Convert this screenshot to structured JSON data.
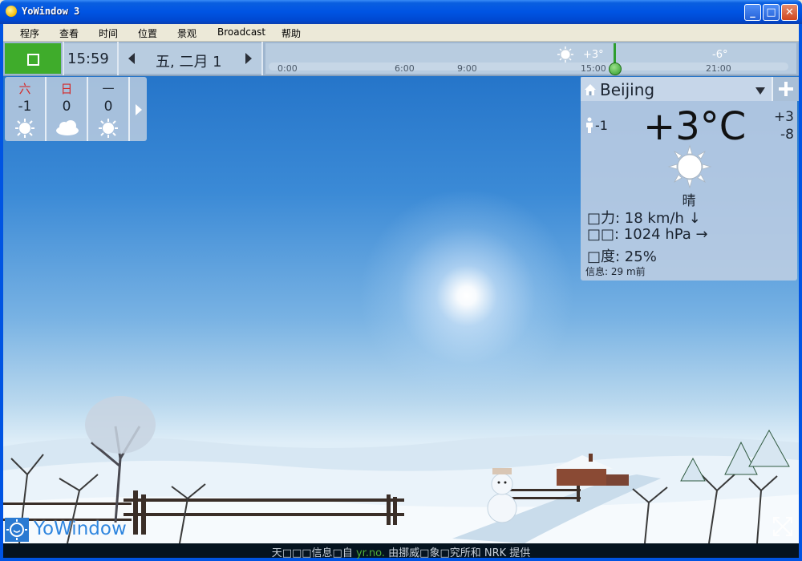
{
  "window": {
    "title": "YoWindow 3"
  },
  "menu": {
    "items": [
      "程序",
      "查看",
      "时间",
      "位置",
      "景观",
      "Broadcast",
      "帮助"
    ]
  },
  "colors": {
    "accent_green": "#3fac2b",
    "sky_top": "#1f6fc6",
    "panel": "#bccee2"
  },
  "timebar": {
    "time": "15:59",
    "date": "五, 二月 1",
    "ticks": [
      "0:00",
      "6:00",
      "9:00",
      "15:00",
      "21:00"
    ],
    "temps": [
      "+3°",
      "-6°"
    ],
    "icons": {
      "sun": "sun-icon"
    }
  },
  "forecast": {
    "days": [
      {
        "name": "六",
        "temp": "-1",
        "icon": "sun-icon",
        "weekend": true
      },
      {
        "name": "日",
        "temp": "0",
        "icon": "cloud-icon",
        "weekend": true
      },
      {
        "name": "一",
        "temp": "0",
        "icon": "sun-icon",
        "weekend": false
      }
    ]
  },
  "panel": {
    "city": "Beijing",
    "feels_like": "-1",
    "temperature": "+3°C",
    "high": "+3",
    "low": "-8",
    "condition": "晴",
    "wind": "□力:  18 km/h ↓",
    "pressure": "□□:  1024 hPa →",
    "humidity": "□度:  25%",
    "updated": "信息:  29 m前"
  },
  "brand": {
    "logo_text": "YoWindow"
  },
  "status": {
    "prefix": "天□□□信息□自 ",
    "link": "yr.no.",
    "suffix": " 由挪威□象□究所和 NRK 提供"
  }
}
